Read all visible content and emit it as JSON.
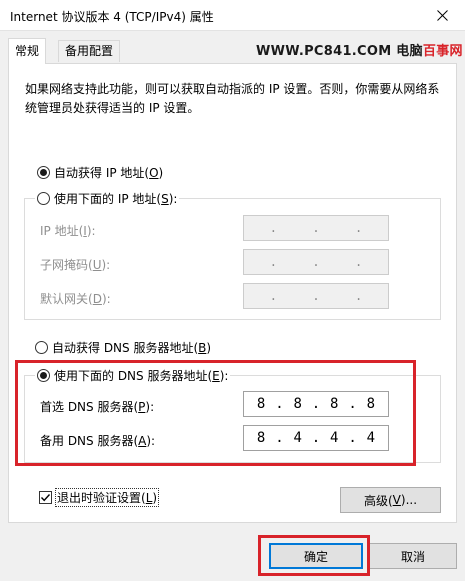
{
  "window": {
    "title": "Internet 协议版本 4 (TCP/IPv4) 属性",
    "close_glyph": "close-icon"
  },
  "tabs": [
    {
      "label": "常规",
      "active": true
    },
    {
      "label": "备用配置",
      "active": false
    }
  ],
  "watermark": {
    "site": "WWW.PC841.COM",
    "brand_prefix": "电脑",
    "brand_suffix": "百事网"
  },
  "general": {
    "description": "如果网络支持此功能，则可以获取自动指派的 IP 设置。否则，你需要从网络系统管理员处获得适当的 IP 设置。",
    "ip_auto": {
      "label": "自动获得 IP 地址(",
      "key": "O",
      "close": ")",
      "checked": true
    },
    "ip_manual": {
      "label": "使用下面的 IP 地址(",
      "key": "S",
      "close": "):",
      "checked": false
    },
    "ip_fields": [
      {
        "label": "IP 地址(",
        "key": "I",
        "close": "):",
        "value": [
          ".",
          ".",
          "."
        ]
      },
      {
        "label": "子网掩码(",
        "key": "U",
        "close": "):",
        "value": [
          ".",
          ".",
          "."
        ]
      },
      {
        "label": "默认网关(",
        "key": "D",
        "close": "):",
        "value": [
          ".",
          ".",
          "."
        ]
      }
    ],
    "dns_auto": {
      "label": "自动获得 DNS 服务器地址(",
      "key": "B",
      "close": ")",
      "checked": false
    },
    "dns_manual": {
      "label": "使用下面的 DNS 服务器地址(",
      "key": "E",
      "close": "):",
      "checked": true
    },
    "dns_preferred": {
      "label": "首选 DNS 服务器(",
      "key": "P",
      "close": "):",
      "octets": [
        "8",
        ".",
        "8",
        ".",
        "8",
        ".",
        "8"
      ]
    },
    "dns_alternate": {
      "label": "备用 DNS 服务器(",
      "key": "A",
      "close": "):",
      "octets": [
        "8",
        ".",
        "4",
        ".",
        "4",
        ".",
        "4"
      ]
    },
    "validate": {
      "label": "退出时验证设置(",
      "key": "L",
      "close": ")",
      "checked": true
    },
    "advanced_button": {
      "label": "高级(",
      "key": "V",
      "close": ")..."
    }
  },
  "footer": {
    "ok_label": "确定",
    "cancel_label": "取消"
  },
  "colors": {
    "highlight_border": "#d8232a",
    "default_button_border": "#0078d7"
  }
}
